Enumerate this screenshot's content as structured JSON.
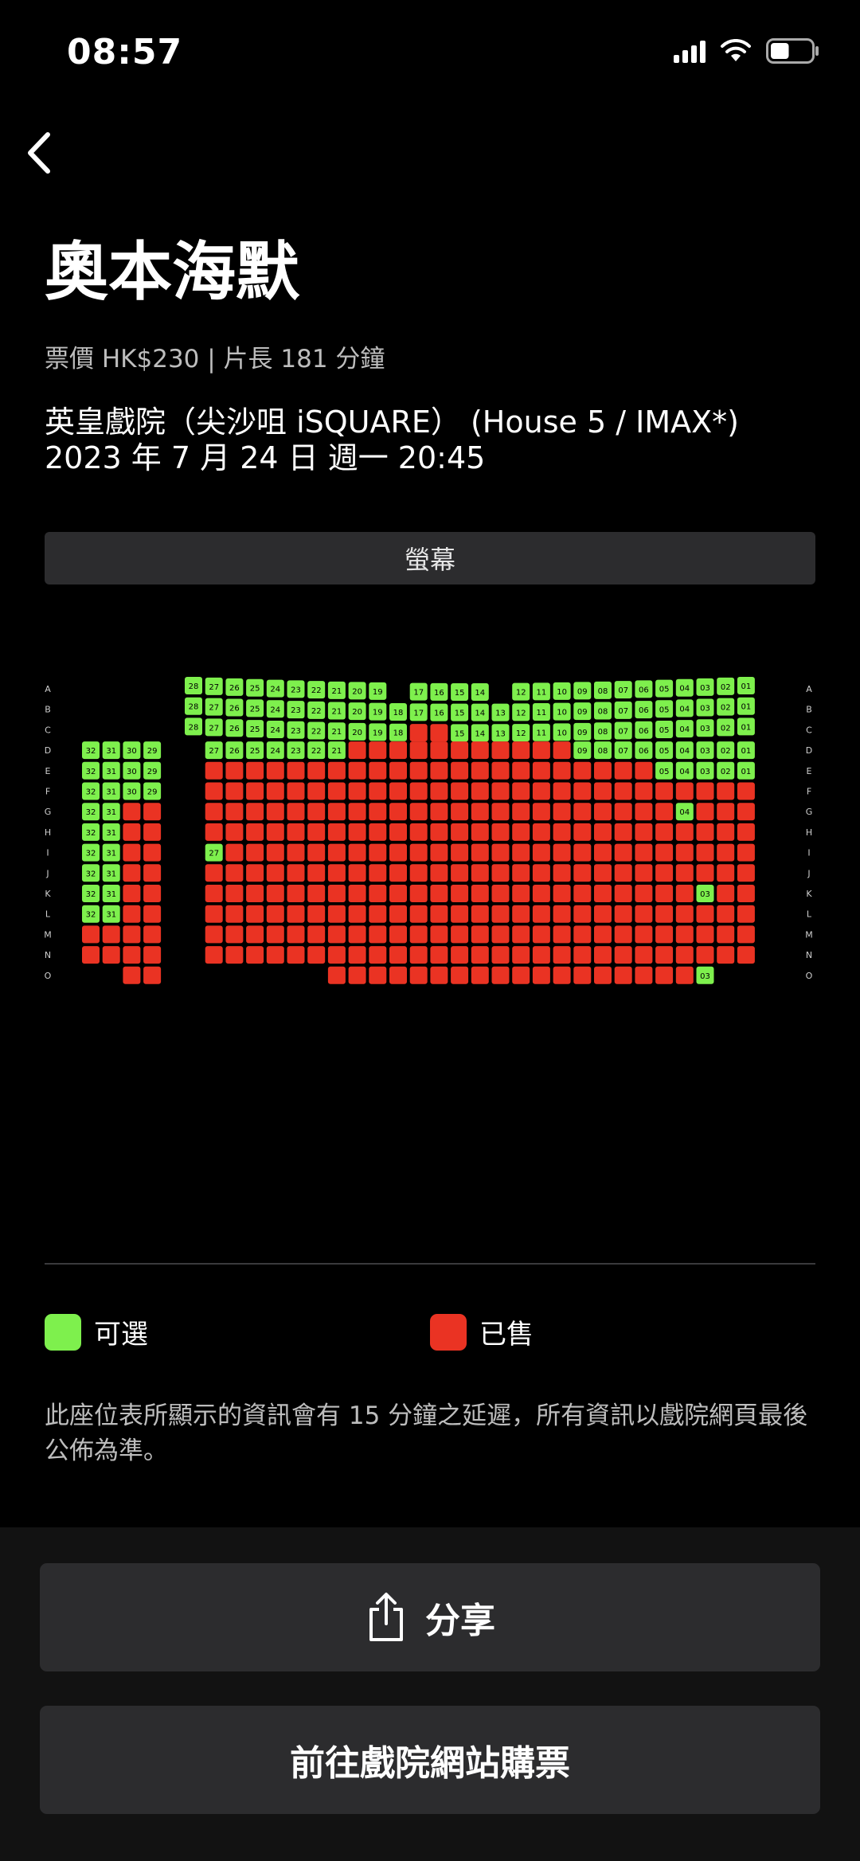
{
  "status": {
    "time": "08:57",
    "battery_level": 0.45
  },
  "movie": {
    "title": "奧本海默",
    "subtitle": "票價 HK$230 | 片長 181 分鐘",
    "venue": "英皇戲院（尖沙咀 iSQUARE） (House 5 / IMAX*)",
    "datetime": "2023 年 7 月 24 日 週一 20:45"
  },
  "screen_label": "螢幕",
  "legend": {
    "available": {
      "label": "可選",
      "color": "#7ef04d"
    },
    "sold": {
      "label": "已售",
      "color": "#ea3323"
    }
  },
  "notice": "此座位表所顯示的資訊會有 15 分鐘之延遲，所有資訊以戲院網頁最後公佈為準。",
  "buttons": {
    "share": "分享",
    "buy": "前往戲院網站購票"
  },
  "icons": {
    "back": "chevron-left-icon",
    "share": "share-icon"
  },
  "seatmap": {
    "rows": [
      "A",
      "B",
      "C",
      "D",
      "E",
      "F",
      "G",
      "H",
      "I",
      "J",
      "K",
      "L",
      "M",
      "N",
      "O"
    ],
    "left_block": {
      "seats": [
        "32",
        "31",
        "30",
        "29"
      ],
      "rows": {
        "D": [
          "a",
          "a",
          "a",
          "a"
        ],
        "E": [
          "a",
          "a",
          "a",
          "a"
        ],
        "F": [
          "a",
          "a",
          "a",
          "a"
        ],
        "G": [
          "a",
          "a",
          "s",
          "s"
        ],
        "H": [
          "a",
          "a",
          "s",
          "s"
        ],
        "I": [
          "a",
          "a",
          "s",
          "s"
        ],
        "J": [
          "a",
          "a",
          "s",
          "s"
        ],
        "K": [
          "a",
          "a",
          "s",
          "s"
        ],
        "L": [
          "a",
          "a",
          "s",
          "s"
        ],
        "M": [
          "s",
          "s",
          "s",
          "s"
        ],
        "N": [
          "s",
          "s",
          "s",
          "s"
        ],
        "O": [
          "-",
          "-",
          "s",
          "s"
        ]
      }
    },
    "right_block": {
      "seats": [
        "28",
        "27",
        "26",
        "25",
        "24",
        "23",
        "22",
        "21",
        "20",
        "19",
        "18",
        "17",
        "16",
        "15",
        "14",
        "13",
        "12",
        "11",
        "10",
        "09",
        "08",
        "07",
        "06",
        "05",
        "04",
        "03",
        "02",
        "01"
      ],
      "rows": {
        "A": [
          "a",
          "a",
          "a",
          "a",
          "a",
          "a",
          "a",
          "a",
          "a",
          "a",
          "-",
          "a",
          "a",
          "a",
          "a",
          "-",
          "a",
          "a",
          "a",
          "a",
          "a",
          "a",
          "a",
          "a",
          "a",
          "a",
          "a",
          "a"
        ],
        "B": [
          "a",
          "a",
          "a",
          "a",
          "a",
          "a",
          "a",
          "a",
          "a",
          "a",
          "a",
          "a",
          "a",
          "a",
          "a",
          "a",
          "a",
          "a",
          "a",
          "a",
          "a",
          "a",
          "a",
          "a",
          "a",
          "a",
          "a",
          "a"
        ],
        "C": [
          "a",
          "a",
          "a",
          "a",
          "a",
          "a",
          "a",
          "a",
          "a",
          "a",
          "a",
          "s",
          "s",
          "a",
          "a",
          "a",
          "a",
          "a",
          "a",
          "a",
          "a",
          "a",
          "a",
          "a",
          "a",
          "a",
          "a",
          "a"
        ],
        "D": [
          "-",
          "a",
          "a",
          "a",
          "a",
          "a",
          "a",
          "a",
          "s",
          "s",
          "s",
          "s",
          "s",
          "s",
          "s",
          "s",
          "s",
          "s",
          "s",
          "a",
          "a",
          "a",
          "a",
          "a",
          "a",
          "a",
          "a",
          "a"
        ],
        "E": [
          "-",
          "s",
          "s",
          "s",
          "s",
          "s",
          "s",
          "s",
          "s",
          "s",
          "s",
          "s",
          "s",
          "s",
          "s",
          "s",
          "s",
          "s",
          "s",
          "s",
          "s",
          "s",
          "s",
          "a",
          "a",
          "a",
          "a",
          "a"
        ],
        "F": [
          "-",
          "s",
          "s",
          "s",
          "s",
          "s",
          "s",
          "s",
          "s",
          "s",
          "s",
          "s",
          "s",
          "s",
          "s",
          "s",
          "s",
          "s",
          "s",
          "s",
          "s",
          "s",
          "s",
          "s",
          "s",
          "s",
          "s",
          "s"
        ],
        "G": [
          "-",
          "s",
          "s",
          "s",
          "s",
          "s",
          "s",
          "s",
          "s",
          "s",
          "s",
          "s",
          "s",
          "s",
          "s",
          "s",
          "s",
          "s",
          "s",
          "s",
          "s",
          "s",
          "s",
          "s",
          "a",
          "s",
          "s",
          "s"
        ],
        "H": [
          "-",
          "s",
          "s",
          "s",
          "s",
          "s",
          "s",
          "s",
          "s",
          "s",
          "s",
          "s",
          "s",
          "s",
          "s",
          "s",
          "s",
          "s",
          "s",
          "s",
          "s",
          "s",
          "s",
          "s",
          "s",
          "s",
          "s",
          "s"
        ],
        "I": [
          "-",
          "a",
          "s",
          "s",
          "s",
          "s",
          "s",
          "s",
          "s",
          "s",
          "s",
          "s",
          "s",
          "s",
          "s",
          "s",
          "s",
          "s",
          "s",
          "s",
          "s",
          "s",
          "s",
          "s",
          "s",
          "s",
          "s",
          "s"
        ],
        "J": [
          "-",
          "s",
          "s",
          "s",
          "s",
          "s",
          "s",
          "s",
          "s",
          "s",
          "s",
          "s",
          "s",
          "s",
          "s",
          "s",
          "s",
          "s",
          "s",
          "s",
          "s",
          "s",
          "s",
          "s",
          "s",
          "s",
          "s",
          "s"
        ],
        "K": [
          "-",
          "s",
          "s",
          "s",
          "s",
          "s",
          "s",
          "s",
          "s",
          "s",
          "s",
          "s",
          "s",
          "s",
          "s",
          "s",
          "s",
          "s",
          "s",
          "s",
          "s",
          "s",
          "s",
          "s",
          "s",
          "a",
          "s",
          "s"
        ],
        "L": [
          "-",
          "s",
          "s",
          "s",
          "s",
          "s",
          "s",
          "s",
          "s",
          "s",
          "s",
          "s",
          "s",
          "s",
          "s",
          "s",
          "s",
          "s",
          "s",
          "s",
          "s",
          "s",
          "s",
          "s",
          "s",
          "s",
          "s",
          "s"
        ],
        "M": [
          "-",
          "s",
          "s",
          "s",
          "s",
          "s",
          "s",
          "s",
          "s",
          "s",
          "s",
          "s",
          "s",
          "s",
          "s",
          "s",
          "s",
          "s",
          "s",
          "s",
          "s",
          "s",
          "s",
          "s",
          "s",
          "s",
          "s",
          "s"
        ],
        "N": [
          "-",
          "s",
          "s",
          "s",
          "s",
          "s",
          "s",
          "s",
          "s",
          "s",
          "s",
          "s",
          "s",
          "s",
          "s",
          "s",
          "s",
          "s",
          "s",
          "s",
          "s",
          "s",
          "s",
          "s",
          "s",
          "s",
          "s",
          "s"
        ],
        "O": [
          "-",
          "-",
          "-",
          "-",
          "-",
          "-",
          "-",
          "s",
          "s",
          "s",
          "s",
          "s",
          "s",
          "s",
          "s",
          "s",
          "s",
          "s",
          "s",
          "s",
          "s",
          "s",
          "s",
          "s",
          "s",
          "a",
          "-",
          "-"
        ]
      }
    }
  }
}
